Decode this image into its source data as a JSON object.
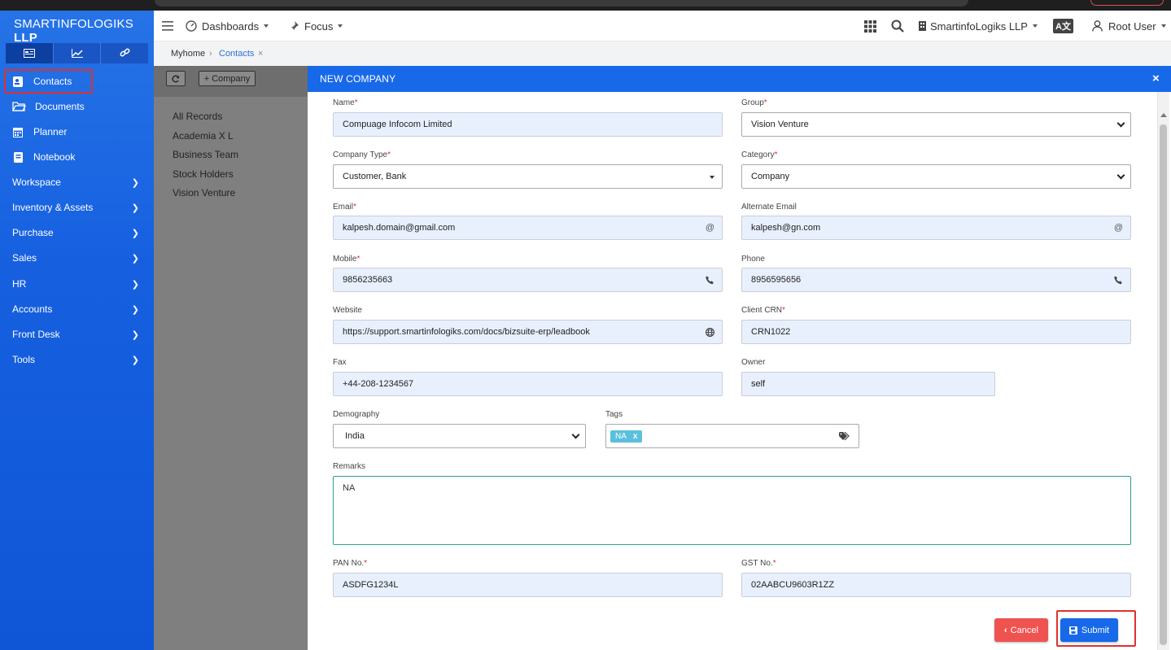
{
  "brand": {
    "name_light": "SMARTINFOLOGIKS",
    "name_bold": "LLP"
  },
  "sidebar": {
    "tabs": [
      {
        "icon": "card-icon"
      },
      {
        "icon": "chart-icon"
      },
      {
        "icon": "link-icon"
      }
    ],
    "items": [
      {
        "label": "Contacts",
        "icon": "contacts-icon"
      },
      {
        "label": "Documents",
        "icon": "folder-icon"
      },
      {
        "label": "Planner",
        "icon": "calendar-icon"
      },
      {
        "label": "Notebook",
        "icon": "notebook-icon"
      },
      {
        "label": "Workspace"
      },
      {
        "label": "Inventory & Assets"
      },
      {
        "label": "Purchase"
      },
      {
        "label": "Sales"
      },
      {
        "label": "HR"
      },
      {
        "label": "Accounts"
      },
      {
        "label": "Front Desk"
      },
      {
        "label": "Tools"
      }
    ]
  },
  "topbar": {
    "dashboards": "Dashboards",
    "focus": "Focus",
    "org": "SmartinfoLogiks LLP",
    "lang": "A文",
    "user": "Root User"
  },
  "breadcrumb": {
    "home": "Myhome",
    "current": "Contacts",
    "close": "×"
  },
  "leftpanel": {
    "add_company": "+ Company",
    "items": [
      "All Records",
      "Academia X L",
      "Business Team",
      "Stock Holders",
      "Vision Venture"
    ]
  },
  "modal": {
    "title": "NEW COMPANY",
    "close": "×",
    "fields": {
      "name": {
        "label": "Name",
        "value": "Compuage Infocom Limited"
      },
      "group": {
        "label": "Group",
        "value": "Vision Venture"
      },
      "company_type": {
        "label": "Company Type",
        "value": "Customer, Bank"
      },
      "category": {
        "label": "Category",
        "value": "Company"
      },
      "email": {
        "label": "Email",
        "value": "kalpesh.domain@gmail.com",
        "suffix": "@"
      },
      "alt_email": {
        "label": "Alternate Email",
        "value": "kalpesh@gn.com",
        "suffix": "@"
      },
      "mobile": {
        "label": "Mobile",
        "value": "9856235663"
      },
      "phone": {
        "label": "Phone",
        "value": "8956595656"
      },
      "website": {
        "label": "Website",
        "value": "https://support.smartinfologiks.com/docs/bizsuite-erp/leadbook"
      },
      "client_crn": {
        "label": "Client CRN",
        "value": "CRN1022"
      },
      "fax": {
        "label": "Fax",
        "value": "+44-208-1234567"
      },
      "owner": {
        "label": "Owner",
        "value": "self"
      },
      "demography": {
        "label": "Demography",
        "value": "India"
      },
      "tags": {
        "label": "Tags",
        "tag": "NA",
        "tag_remove": "x"
      },
      "remarks": {
        "label": "Remarks",
        "value": "NA"
      },
      "pan": {
        "label": "PAN No.",
        "value": "ASDFG1234L"
      },
      "gst": {
        "label": "GST No.",
        "value": "02AABCU9603R1ZZ"
      }
    },
    "required_mark": "*",
    "cancel": "Cancel",
    "submit": "Submit"
  },
  "colors": {
    "sidebar": "#1660e0",
    "header": "#1769e9",
    "cancel": "#ef5350",
    "highlight": "#e0312e",
    "field_bg": "#e8f0fe"
  }
}
